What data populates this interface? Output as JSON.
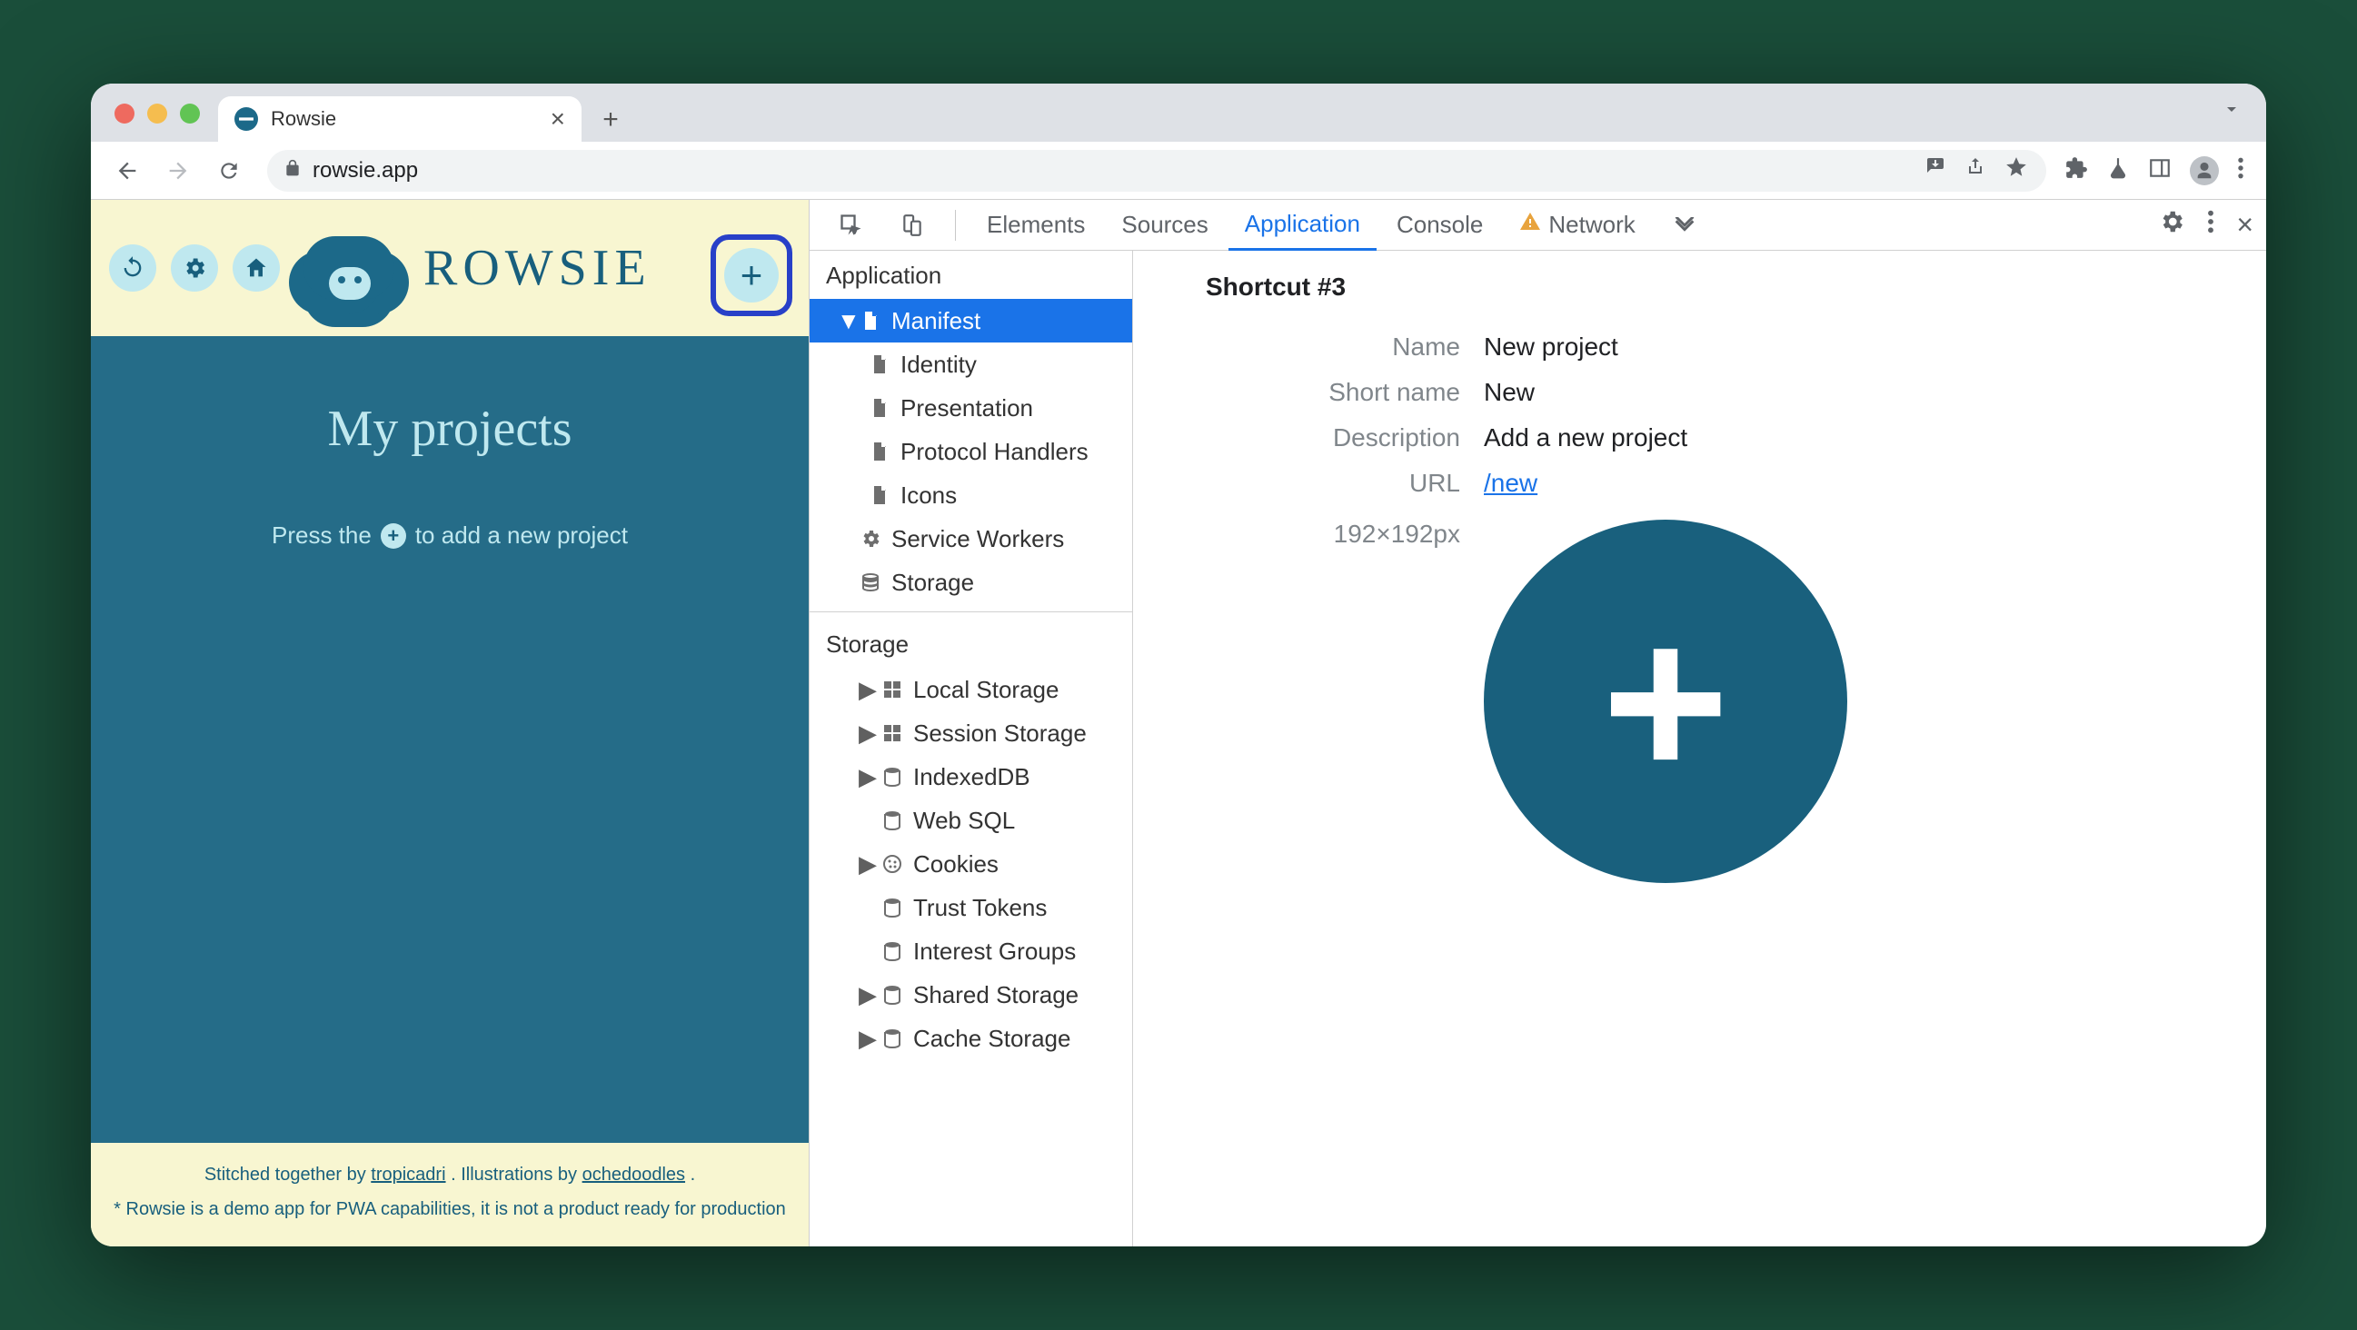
{
  "browser": {
    "tab_title": "Rowsie",
    "url": "rowsie.app"
  },
  "app": {
    "wordmark": "ROWSIE",
    "title": "My projects",
    "hint_before": "Press the",
    "hint_after": "to add a new project",
    "footer_prefix": "Stitched together by ",
    "footer_author": "tropicadri",
    "footer_mid": ". Illustrations by ",
    "footer_illustrator": "ochedoodles",
    "footer_suffix": ".",
    "disclaimer": "* Rowsie is a demo app for PWA capabilities, it is not a product ready for production"
  },
  "devtools": {
    "tabs": {
      "elements": "Elements",
      "sources": "Sources",
      "application": "Application",
      "console": "Console",
      "network": "Network"
    },
    "sidebar": {
      "group_app": "Application",
      "manifest": "Manifest",
      "identity": "Identity",
      "presentation": "Presentation",
      "protocol": "Protocol Handlers",
      "icons": "Icons",
      "sw": "Service Workers",
      "storage": "Storage",
      "group_storage": "Storage",
      "ls": "Local Storage",
      "ss": "Session Storage",
      "idb": "IndexedDB",
      "websql": "Web SQL",
      "cookies": "Cookies",
      "tt": "Trust Tokens",
      "ig": "Interest Groups",
      "shs": "Shared Storage",
      "cs": "Cache Storage"
    },
    "pane": {
      "heading": "Shortcut #3",
      "labels": {
        "name": "Name",
        "short_name": "Short name",
        "description": "Description",
        "url": "URL"
      },
      "values": {
        "name": "New project",
        "short_name": "New",
        "description": "Add a new project",
        "url": "/new"
      },
      "icon_dim": "192×192px"
    }
  }
}
